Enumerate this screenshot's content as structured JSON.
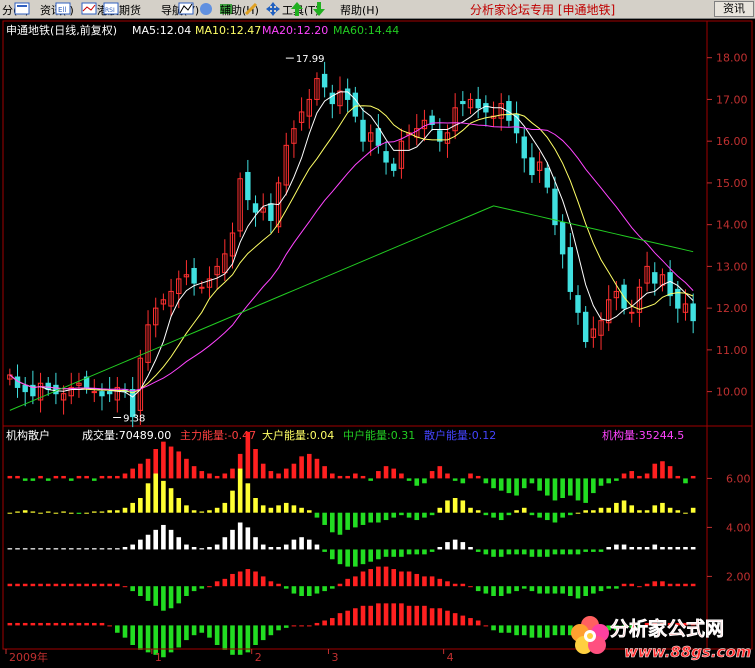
{
  "menu": {
    "items": [
      {
        "name": "menu-view",
        "label": "分(A)",
        "x": 0
      },
      {
        "name": "menu-info",
        "label": "资讯(I)",
        "x": 40
      },
      {
        "name": "menu-hk",
        "label": "港股期货",
        "x": 97
      },
      {
        "name": "menu-nav",
        "label": "导航(V)",
        "x": 161
      },
      {
        "name": "menu-aux",
        "label": "辅助(H)",
        "x": 220
      },
      {
        "name": "menu-tools",
        "label": "工具(T)",
        "x": 282
      },
      {
        "name": "menu-help",
        "label": "帮助(H)",
        "x": 340
      }
    ],
    "header_text": "分析家论坛专用 [申通地铁]",
    "right_button": "资讯"
  },
  "chart_data": [
    {
      "type": "candlestick",
      "title": "申通地铁(日线,前复权)",
      "ma_legend": [
        {
          "name": "MA5",
          "value": "12.04",
          "color": "#ffffff"
        },
        {
          "name": "MA10",
          "value": "12.47",
          "color": "#ffff66"
        },
        {
          "name": "MA20",
          "value": "12.20",
          "color": "#ff44ff"
        },
        {
          "name": "MA60",
          "value": "14.44",
          "color": "#22cc22"
        }
      ],
      "ylim": [
        9.2,
        18.4
      ],
      "yticks": [
        "18.00",
        "17.00",
        "16.00",
        "15.00",
        "14.00",
        "13.00",
        "12.00",
        "11.00",
        "10.00"
      ],
      "annotations": [
        {
          "text": "17.99",
          "value": 17.99,
          "bar_fraction": 0.405
        },
        {
          "text": "9.38",
          "value": 9.38,
          "bar_fraction": 0.155
        }
      ],
      "close_series": [
        10.4,
        10.1,
        10.0,
        9.9,
        10.2,
        10.05,
        9.95,
        9.95,
        10.1,
        10.2,
        10.1,
        10.0,
        9.9,
        9.95,
        10.1,
        10.0,
        9.4,
        10.8,
        11.6,
        12.0,
        12.2,
        12.4,
        12.7,
        12.8,
        12.6,
        12.5,
        12.7,
        13.0,
        13.3,
        13.8,
        15.1,
        14.6,
        14.3,
        14.4,
        14.1,
        15.0,
        15.9,
        16.3,
        16.7,
        17.0,
        17.5,
        17.3,
        16.9,
        17.2,
        17.0,
        16.6,
        16.0,
        16.2,
        15.9,
        15.5,
        15.3,
        16.0,
        16.2,
        16.3,
        16.5,
        16.4,
        16.0,
        16.2,
        16.8,
        16.9,
        17.0,
        16.8,
        16.7,
        16.6,
        16.9,
        16.5,
        16.2,
        15.6,
        15.2,
        15.5,
        14.9,
        14.0,
        13.3,
        12.4,
        11.9,
        11.2,
        11.5,
        11.7,
        12.2,
        12.4,
        12.0,
        11.9,
        12.5,
        13.0,
        12.6,
        12.8,
        12.3,
        12.0,
        12.1,
        11.7
      ],
      "bars_visible": 90
    },
    {
      "type": "bar",
      "title": "机构散户",
      "legend": [
        {
          "label": "成交量:70489.00",
          "color": "#ffffff"
        },
        {
          "label": "主力能量:-0.47",
          "color": "#ff4040"
        },
        {
          "label": "大户能量:0.04",
          "color": "#ffff66"
        },
        {
          "label": "中户能量:0.31",
          "color": "#22cc22"
        },
        {
          "label": "散户能量:0.12",
          "color": "#4444ff"
        },
        {
          "label": "机构量:35244.5",
          "color": "#ff44ff"
        }
      ],
      "yticks": [
        "6.00",
        "4.00",
        "2.00"
      ],
      "series": [
        {
          "name": "主力能量",
          "base": 6.0,
          "color_pos": "#ff2020",
          "color_neg": "#22dd22",
          "values": [
            0.1,
            0.1,
            -0.1,
            -0.1,
            0.1,
            -0.1,
            0.1,
            0.1,
            -0.1,
            0.1,
            0.1,
            -0.1,
            0.1,
            0.1,
            0.1,
            0.2,
            0.4,
            0.6,
            0.8,
            1.2,
            1.5,
            1.3,
            1.1,
            0.8,
            0.5,
            0.3,
            0.2,
            0.1,
            0.2,
            0.4,
            1.0,
            1.9,
            1.2,
            0.6,
            0.3,
            0.2,
            0.4,
            0.6,
            0.9,
            1.0,
            0.8,
            0.5,
            0.2,
            0.1,
            0.1,
            0.2,
            0.1,
            -0.1,
            0.3,
            0.5,
            0.4,
            0.2,
            -0.1,
            -0.3,
            -0.2,
            0.3,
            0.5,
            0.2,
            -0.1,
            -0.2,
            0.2,
            0.1,
            -0.2,
            -0.4,
            -0.5,
            -0.6,
            -0.7,
            -0.4,
            -0.2,
            -0.5,
            -0.7,
            -0.9,
            -0.8,
            -0.7,
            -0.9,
            -1.0,
            -0.6,
            -0.3,
            -0.2,
            -0.1,
            0.2,
            0.3,
            0.1,
            0.2,
            0.6,
            0.7,
            0.5,
            0.1,
            -0.2,
            0.1
          ]
        },
        {
          "name": "大户能量",
          "base": 4.6,
          "color_pos": "#ffff33",
          "color_neg": "#22dd22",
          "values": [
            0.0,
            0.05,
            0.1,
            0.05,
            0.0,
            0.05,
            0.0,
            0.05,
            0.0,
            -0.05,
            0.0,
            0.05,
            0.05,
            0.1,
            0.1,
            0.2,
            0.4,
            0.6,
            1.2,
            1.6,
            1.3,
            1.0,
            0.6,
            0.3,
            0.1,
            0.05,
            0.1,
            0.2,
            0.4,
            0.9,
            1.8,
            1.2,
            0.6,
            0.3,
            0.2,
            0.3,
            0.4,
            0.3,
            0.2,
            0.1,
            -0.2,
            -0.5,
            -0.8,
            -0.9,
            -0.7,
            -0.6,
            -0.5,
            -0.4,
            -0.4,
            -0.3,
            -0.2,
            -0.1,
            -0.2,
            -0.3,
            -0.2,
            -0.1,
            0.2,
            0.5,
            0.6,
            0.5,
            0.2,
            0.1,
            -0.1,
            -0.2,
            -0.3,
            -0.1,
            0.1,
            0.2,
            -0.1,
            -0.2,
            -0.3,
            -0.4,
            -0.2,
            -0.1,
            0.0,
            0.1,
            0.1,
            0.2,
            0.2,
            0.4,
            0.5,
            0.3,
            0.1,
            0.1,
            0.3,
            0.4,
            0.2,
            0.1,
            0.0,
            0.2
          ]
        },
        {
          "name": "中户能量",
          "base": 3.1,
          "color_pos": "#ffffff",
          "color_neg": "#22dd22",
          "values": [
            0.05,
            0.05,
            0.05,
            0.05,
            0.05,
            0.05,
            0.05,
            0.05,
            0.05,
            0.05,
            0.05,
            0.05,
            0.05,
            0.05,
            0.05,
            0.1,
            0.2,
            0.4,
            0.6,
            0.8,
            1.0,
            0.8,
            0.5,
            0.2,
            0.1,
            0.05,
            0.1,
            0.2,
            0.5,
            0.8,
            1.1,
            0.9,
            0.5,
            0.2,
            0.1,
            0.1,
            0.2,
            0.4,
            0.5,
            0.4,
            0.2,
            -0.1,
            -0.4,
            -0.6,
            -0.7,
            -0.7,
            -0.6,
            -0.5,
            -0.4,
            -0.3,
            -0.3,
            -0.3,
            -0.2,
            -0.2,
            -0.2,
            -0.1,
            0.1,
            0.3,
            0.4,
            0.3,
            0.1,
            -0.1,
            -0.2,
            -0.3,
            -0.3,
            -0.2,
            -0.2,
            -0.2,
            -0.3,
            -0.3,
            -0.3,
            -0.2,
            -0.2,
            -0.2,
            -0.2,
            -0.1,
            -0.1,
            -0.1,
            0.1,
            0.2,
            0.2,
            0.1,
            0.1,
            0.1,
            0.2,
            0.1,
            0.1,
            0.1,
            0.1,
            0.1
          ]
        },
        {
          "name": "散户能量",
          "base": 1.6,
          "color_pos": "#ff2020",
          "color_neg": "#22dd22",
          "values": [
            0.1,
            0.1,
            0.1,
            0.1,
            0.1,
            0.1,
            0.1,
            0.1,
            0.1,
            0.1,
            0.1,
            0.1,
            0.1,
            0.1,
            0.1,
            0.0,
            -0.2,
            -0.4,
            -0.6,
            -0.8,
            -1.0,
            -0.9,
            -0.7,
            -0.4,
            -0.2,
            -0.1,
            0.0,
            0.2,
            0.3,
            0.5,
            0.6,
            0.7,
            0.6,
            0.4,
            0.2,
            0.1,
            -0.1,
            -0.3,
            -0.4,
            -0.4,
            -0.3,
            -0.2,
            -0.1,
            0.1,
            0.3,
            0.4,
            0.6,
            0.7,
            0.8,
            0.8,
            0.7,
            0.6,
            0.6,
            0.5,
            0.4,
            0.4,
            0.3,
            0.2,
            0.1,
            0.1,
            0.0,
            -0.2,
            -0.3,
            -0.4,
            -0.4,
            -0.3,
            -0.2,
            -0.1,
            -0.2,
            -0.3,
            -0.3,
            -0.3,
            -0.3,
            -0.4,
            -0.5,
            -0.4,
            -0.3,
            -0.2,
            -0.1,
            -0.1,
            0.1,
            0.1,
            0.0,
            0.1,
            0.2,
            0.2,
            0.1,
            0.1,
            0.1,
            0.1
          ]
        },
        {
          "name": "机构量",
          "base": 0.0,
          "color_pos": "#ff2020",
          "color_neg": "#22dd22",
          "values": [
            0.1,
            0.1,
            0.1,
            0.1,
            0.1,
            0.1,
            0.1,
            0.1,
            0.1,
            0.1,
            0.1,
            0.1,
            0.1,
            0.0,
            -0.3,
            -0.5,
            -0.8,
            -1.0,
            -1.1,
            -1.2,
            -1.3,
            -1.1,
            -0.9,
            -0.6,
            -0.4,
            -0.3,
            -0.5,
            -0.8,
            -1.0,
            -1.2,
            -1.2,
            -1.1,
            -0.8,
            -0.6,
            -0.4,
            -0.2,
            -0.1,
            0.0,
            0.0,
            0.0,
            0.1,
            0.2,
            0.3,
            0.5,
            0.6,
            0.7,
            0.8,
            0.8,
            0.9,
            0.9,
            0.9,
            0.9,
            0.8,
            0.8,
            0.8,
            0.7,
            0.7,
            0.6,
            0.5,
            0.4,
            0.3,
            0.2,
            0.0,
            -0.2,
            -0.3,
            -0.3,
            -0.4,
            -0.4,
            -0.5,
            -0.5,
            -0.5,
            -0.4,
            -0.4,
            -0.4,
            -0.3,
            -0.3,
            -0.3,
            -0.2,
            -0.2,
            -0.2,
            -0.1,
            -0.1,
            -0.1,
            0.1,
            0.1,
            0.1,
            0.1,
            0.1,
            0.1,
            0.1
          ]
        }
      ]
    }
  ],
  "xaxis": {
    "labels": [
      {
        "text": "2009年",
        "bar": 0
      },
      {
        "text": "1",
        "bar": 19
      },
      {
        "text": "2",
        "bar": 32
      },
      {
        "text": "3",
        "bar": 42
      },
      {
        "text": "4",
        "bar": 57
      }
    ]
  },
  "watermark": {
    "logo_text": "分析家公式网",
    "url": "www.88gs.com"
  }
}
